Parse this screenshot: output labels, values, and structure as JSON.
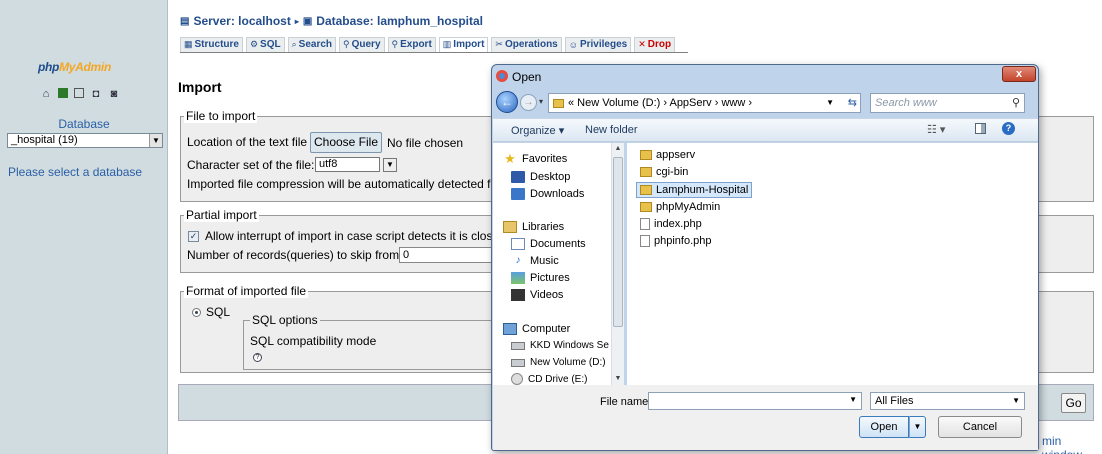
{
  "sidebar": {
    "logo_part1": "php",
    "logo_part2": "MyAdmin",
    "database_label": "Database",
    "database_select_value": "_hospital (19)",
    "select_db_message": "Please select a database",
    "icons": [
      "home-icon",
      "sql-query-icon",
      "window-icon",
      "docs-icon",
      "info-icon"
    ]
  },
  "header": {
    "server_text": "Server: localhost",
    "database_text": "Database: lamphum_hospital",
    "tabs": [
      {
        "label": "Structure",
        "icon": "structure-icon"
      },
      {
        "label": "SQL",
        "icon": "sql-icon"
      },
      {
        "label": "Search",
        "icon": "search-icon"
      },
      {
        "label": "Query",
        "icon": "query-icon"
      },
      {
        "label": "Export",
        "icon": "export-icon"
      },
      {
        "label": "Import",
        "icon": "import-icon"
      },
      {
        "label": "Operations",
        "icon": "operations-icon"
      },
      {
        "label": "Privileges",
        "icon": "privileges-icon"
      },
      {
        "label": "Drop",
        "icon": "drop-icon"
      }
    ]
  },
  "page": {
    "heading": "Import",
    "file_legend": "File to import",
    "location_label": "Location of the text file",
    "choose_file": "Choose File",
    "no_file": "No file chosen",
    "charset_label": "Character set of the file:",
    "charset_value": "utf8",
    "compression_text": "Imported file compression will be automatically detected fro",
    "partial_legend": "Partial import",
    "allow_interrupt": "Allow interrupt of import in case script detects it is close",
    "skip_label": "Number of records(queries) to skip from start",
    "skip_value": "0",
    "format_legend": "Format of imported file",
    "format_sql": "SQL",
    "sql_options_legend": "SQL options",
    "sql_compat": "SQL compatibility mode",
    "go_button": "Go",
    "admin_link": "min window"
  },
  "dialog": {
    "title": "Open",
    "close": "x",
    "address": "« New Volume (D:) › AppServ › www ›",
    "search_placeholder": "Search www",
    "organize": "Organize ▾",
    "new_folder": "New folder",
    "nav": {
      "favorites": "Favorites",
      "desktop": "Desktop",
      "downloads": "Downloads",
      "libraries": "Libraries",
      "documents": "Documents",
      "music": "Music",
      "pictures": "Pictures",
      "videos": "Videos",
      "computer": "Computer",
      "kkd": "KKD Windows Se",
      "newvolume": "New Volume (D:)",
      "cddrive": "CD Drive (E:)"
    },
    "files": [
      {
        "name": "appserv",
        "type": "folder"
      },
      {
        "name": "cgi-bin",
        "type": "folder"
      },
      {
        "name": "Lamphum-Hospital",
        "type": "folder"
      },
      {
        "name": "phpMyAdmin",
        "type": "folder"
      },
      {
        "name": "index.php",
        "type": "file"
      },
      {
        "name": "phpinfo.php",
        "type": "file"
      }
    ],
    "filename_label": "File name:",
    "filename_value": "",
    "filetype_value": "All Files",
    "open_button": "Open",
    "cancel_button": "Cancel"
  }
}
